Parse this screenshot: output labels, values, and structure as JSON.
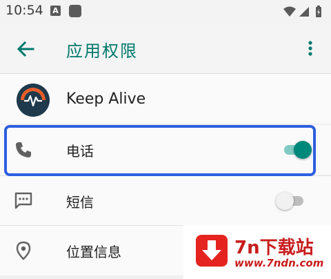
{
  "statusbar": {
    "time": "10:54",
    "notif_letter": "A"
  },
  "appbar": {
    "title": "应用权限"
  },
  "app": {
    "name": "Keep Alive"
  },
  "permissions": [
    {
      "label": "电话",
      "enabled": true,
      "icon": "phone-icon"
    },
    {
      "label": "短信",
      "enabled": false,
      "icon": "sms-icon"
    },
    {
      "label": "位置信息",
      "enabled": false,
      "icon": "location-icon"
    }
  ],
  "watermark": {
    "title": "7n下载站",
    "url": "www.7ndn.com"
  },
  "colors": {
    "accent": "#00796b",
    "switch_on_thumb": "#00897b",
    "switch_on_track": "#80cbc4",
    "switch_off_thumb": "#f1f1f1",
    "switch_off_track": "#bdbdbd",
    "highlight": "#2c5fe0"
  }
}
